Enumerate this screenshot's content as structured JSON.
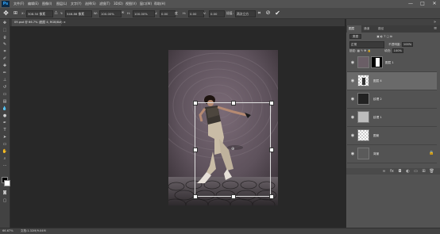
{
  "app": {
    "logo": "Ps"
  },
  "menu": [
    "文件(F)",
    "编辑(E)",
    "图像(I)",
    "图层(L)",
    "文字(Y)",
    "选择(S)",
    "滤镜(T)",
    "3D(D)",
    "视图(V)",
    "窗口(W)",
    "帮助(H)"
  ],
  "window_controls": {
    "minimize": "—",
    "maximize": "□",
    "close": "✕"
  },
  "options": {
    "x_label": "X:",
    "x_value": "308.50 像素",
    "y_label": "Y:",
    "y_value": "546.86 像素",
    "w_label": "W:",
    "w_value": "100.00%",
    "h_label": "H:",
    "h_value": "100.00%",
    "rot_value": "0.00",
    "hskew_label": "H:",
    "hskew_value": "0.00",
    "vskew_label": "V:",
    "vskew_value": "0.00",
    "interp_label": "插值:",
    "interp_value": "两次立方",
    "cancel_icon": "cancel-icon",
    "commit_icon": "commit-icon"
  },
  "document": {
    "tab_title": "09.psd @ 66.7% (图层 4, RGB/8#)",
    "tab_close": "×"
  },
  "status": {
    "zoom": "66.67%",
    "doc_info": "文档:1.32M/9.04M"
  },
  "panel": {
    "tabs": [
      "图层",
      "通道",
      "路径"
    ],
    "kind_label": "类型",
    "blend_mode": "正常",
    "opacity_label": "不透明度:",
    "opacity_value": "100%",
    "lock_label": "锁定:",
    "fill_label": "填充:",
    "fill_value": "100%",
    "layers": [
      {
        "name": "图层 1",
        "selected": false
      },
      {
        "name": "图层 4",
        "selected": true
      },
      {
        "name": "纹理 2",
        "selected": false
      },
      {
        "name": "纹理 1",
        "selected": false
      },
      {
        "name": "图案",
        "selected": false
      },
      {
        "name": "背景",
        "selected": false
      }
    ]
  },
  "colors": {
    "accent": "#31a8ff",
    "ui_dark": "#282828",
    "panel": "#535353"
  }
}
